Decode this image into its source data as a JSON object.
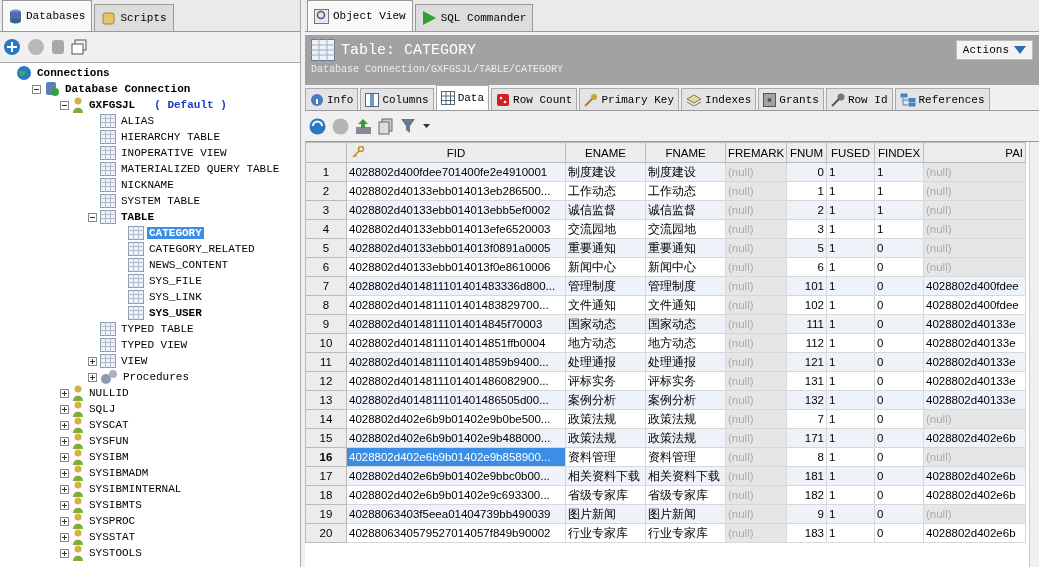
{
  "left_tabs": [
    {
      "label": "Databases",
      "selected": true
    },
    {
      "label": "Scripts",
      "selected": false
    }
  ],
  "tree": [
    {
      "label": "Connections",
      "kind": "globe",
      "bold": true,
      "selected": false,
      "children": [
        {
          "label": "Database Connection",
          "kind": "db",
          "bold": true,
          "selected": false,
          "expanded": true,
          "children": [
            {
              "label": "GXFGSJL",
              "note": "( Default )",
              "kind": "schema",
              "bold": true,
              "selected": false,
              "expanded": true,
              "children": [
                {
                  "label": "ALIAS",
                  "kind": "table",
                  "bold": false,
                  "selected": false
                },
                {
                  "label": "HIERARCHY TABLE",
                  "kind": "table",
                  "bold": false,
                  "selected": false
                },
                {
                  "label": "INOPERATIVE VIEW",
                  "kind": "table",
                  "bold": false,
                  "selected": false
                },
                {
                  "label": "MATERIALIZED QUERY TABLE",
                  "kind": "table",
                  "bold": false,
                  "selected": false
                },
                {
                  "label": "NICKNAME",
                  "kind": "table",
                  "bold": false,
                  "selected": false
                },
                {
                  "label": "SYSTEM TABLE",
                  "kind": "table",
                  "bold": false,
                  "selected": false
                },
                {
                  "label": "TABLE",
                  "kind": "table",
                  "bold": true,
                  "selected": false,
                  "expanded": true,
                  "children": [
                    {
                      "label": "CATEGORY",
                      "kind": "table",
                      "bold": true,
                      "selected": true
                    },
                    {
                      "label": "CATEGORY_RELATED",
                      "kind": "table",
                      "bold": false,
                      "selected": false
                    },
                    {
                      "label": "NEWS_CONTENT",
                      "kind": "table",
                      "bold": false,
                      "selected": false
                    },
                    {
                      "label": "SYS_FILE",
                      "kind": "table",
                      "bold": false,
                      "selected": false
                    },
                    {
                      "label": "SYS_LINK",
                      "kind": "table",
                      "bold": false,
                      "selected": false
                    },
                    {
                      "label": "SYS_USER",
                      "kind": "table",
                      "bold": true,
                      "selected": false
                    }
                  ]
                },
                {
                  "label": "TYPED TABLE",
                  "kind": "table",
                  "bold": false,
                  "selected": false
                },
                {
                  "label": "TYPED VIEW",
                  "kind": "table",
                  "bold": false,
                  "selected": false
                },
                {
                  "label": "VIEW",
                  "kind": "table",
                  "bold": false,
                  "selected": false,
                  "expanded": false
                },
                {
                  "label": "Procedures",
                  "kind": "gears",
                  "bold": false,
                  "selected": false,
                  "expanded": false
                }
              ]
            },
            {
              "label": "NULLID",
              "kind": "schema",
              "bold": false,
              "selected": false,
              "expanded": false
            },
            {
              "label": "SQLJ",
              "kind": "schema",
              "bold": false,
              "selected": false,
              "expanded": false
            },
            {
              "label": "SYSCAT",
              "kind": "schema",
              "bold": false,
              "selected": false,
              "expanded": false
            },
            {
              "label": "SYSFUN",
              "kind": "schema",
              "bold": false,
              "selected": false,
              "expanded": false
            },
            {
              "label": "SYSIBM",
              "kind": "schema",
              "bold": false,
              "selected": false,
              "expanded": false
            },
            {
              "label": "SYSIBMADM",
              "kind": "schema",
              "bold": false,
              "selected": false,
              "expanded": false
            },
            {
              "label": "SYSIBMINTERNAL",
              "kind": "schema",
              "bold": false,
              "selected": false,
              "expanded": false
            },
            {
              "label": "SYSIBMTS",
              "kind": "schema",
              "bold": false,
              "selected": false,
              "expanded": false
            },
            {
              "label": "SYSPROC",
              "kind": "schema",
              "bold": false,
              "selected": false,
              "expanded": false
            },
            {
              "label": "SYSSTAT",
              "kind": "schema",
              "bold": false,
              "selected": false,
              "expanded": false
            },
            {
              "label": "SYSTOOLS",
              "kind": "schema",
              "bold": false,
              "selected": false,
              "expanded": false
            }
          ]
        }
      ]
    }
  ],
  "main_tabs": [
    {
      "label": "Object View",
      "selected": true
    },
    {
      "label": "SQL Commander",
      "selected": false
    }
  ],
  "object": {
    "title": "Table: CATEGORY",
    "path": "Database Connection/GXFGSJL/TABLE/CATEGORY",
    "actions": "Actions"
  },
  "sub_tabs": [
    {
      "label": "Info",
      "selected": false
    },
    {
      "label": "Columns",
      "selected": false
    },
    {
      "label": "Data",
      "selected": true
    },
    {
      "label": "Row Count",
      "selected": false
    },
    {
      "label": "Primary Key",
      "selected": false
    },
    {
      "label": "Indexes",
      "selected": false
    },
    {
      "label": "Grants",
      "selected": false
    },
    {
      "label": "Row Id",
      "selected": false
    },
    {
      "label": "References",
      "selected": false
    }
  ],
  "table": {
    "columns": [
      {
        "label": "FID",
        "key": true
      },
      {
        "label": "ENAME",
        "key": false
      },
      {
        "label": "FNAME",
        "key": false
      },
      {
        "label": "FREMARK",
        "key": false
      },
      {
        "label": "FNUM",
        "key": false
      },
      {
        "label": "FUSED",
        "key": false
      },
      {
        "label": "FINDEX",
        "key": false
      },
      {
        "label": "PAI",
        "key": false
      }
    ],
    "rows": [
      {
        "num": "1",
        "selected": false,
        "fremark_null": true,
        "pai_null": true,
        "cells": [
          "4028802d400fdee701400fe2e4910001",
          "制度建设",
          "制度建设",
          "(null)",
          "0",
          "1",
          "1",
          "(null)"
        ]
      },
      {
        "num": "2",
        "selected": false,
        "fremark_null": true,
        "pai_null": true,
        "cells": [
          "4028802d40133ebb014013eb286500...",
          "工作动态",
          "工作动态",
          "(null)",
          "1",
          "1",
          "1",
          "(null)"
        ]
      },
      {
        "num": "3",
        "selected": false,
        "fremark_null": true,
        "pai_null": true,
        "cells": [
          "4028802d40133ebb014013ebb5ef0002",
          "诚信监督",
          "诚信监督",
          "(null)",
          "2",
          "1",
          "1",
          "(null)"
        ]
      },
      {
        "num": "4",
        "selected": false,
        "fremark_null": true,
        "pai_null": true,
        "cells": [
          "4028802d40133ebb014013efe6520003",
          "交流园地",
          "交流园地",
          "(null)",
          "3",
          "1",
          "1",
          "(null)"
        ]
      },
      {
        "num": "5",
        "selected": false,
        "fremark_null": true,
        "pai_null": true,
        "cells": [
          "4028802d40133ebb014013f0891a0005",
          "重要通知",
          "重要通知",
          "(null)",
          "5",
          "1",
          "0",
          "(null)"
        ]
      },
      {
        "num": "6",
        "selected": false,
        "fremark_null": true,
        "pai_null": true,
        "cells": [
          "4028802d40133ebb014013f0e8610006",
          "新闻中心",
          "新闻中心",
          "(null)",
          "6",
          "1",
          "0",
          "(null)"
        ]
      },
      {
        "num": "7",
        "selected": false,
        "fremark_null": true,
        "pai_null": false,
        "cells": [
          "4028802d4014811101401483336d800...",
          "管理制度",
          "管理制度",
          "(null)",
          "101",
          "1",
          "0",
          "4028802d400fdee"
        ]
      },
      {
        "num": "8",
        "selected": false,
        "fremark_null": true,
        "pai_null": false,
        "cells": [
          "4028802d4014811101401483829700...",
          "文件通知",
          "文件通知",
          "(null)",
          "102",
          "1",
          "0",
          "4028802d400fdee"
        ]
      },
      {
        "num": "9",
        "selected": false,
        "fremark_null": true,
        "pai_null": false,
        "cells": [
          "4028802d40148111014014845f70003",
          "国家动态",
          "国家动态",
          "(null)",
          "111",
          "1",
          "0",
          "4028802d40133e"
        ]
      },
      {
        "num": "10",
        "selected": false,
        "fremark_null": true,
        "pai_null": false,
        "cells": [
          "4028802d40148111014014851ffb0004",
          "地方动态",
          "地方动态",
          "(null)",
          "112",
          "1",
          "0",
          "4028802d40133e"
        ]
      },
      {
        "num": "11",
        "selected": false,
        "fremark_null": true,
        "pai_null": false,
        "cells": [
          "4028802d40148111014014859b9400...",
          "处理通报",
          "处理通报",
          "(null)",
          "121",
          "1",
          "0",
          "4028802d40133e"
        ]
      },
      {
        "num": "12",
        "selected": false,
        "fremark_null": true,
        "pai_null": false,
        "cells": [
          "4028802d4014811101401486082900...",
          "评标实务",
          "评标实务",
          "(null)",
          "131",
          "1",
          "0",
          "4028802d40133e"
        ]
      },
      {
        "num": "13",
        "selected": false,
        "fremark_null": true,
        "pai_null": false,
        "cells": [
          "4028802d4014811101401486505d00...",
          "案例分析",
          "案例分析",
          "(null)",
          "132",
          "1",
          "0",
          "4028802d40133e"
        ]
      },
      {
        "num": "14",
        "selected": false,
        "fremark_null": true,
        "pai_null": true,
        "cells": [
          "4028802d402e6b9b01402e9b0be500...",
          "政策法规",
          "政策法规",
          "(null)",
          "7",
          "1",
          "0",
          "(null)"
        ]
      },
      {
        "num": "15",
        "selected": false,
        "fremark_null": true,
        "pai_null": false,
        "cells": [
          "4028802d402e6b9b01402e9b488000...",
          "政策法规",
          "政策法规",
          "(null)",
          "171",
          "1",
          "0",
          "4028802d402e6b"
        ]
      },
      {
        "num": "16",
        "selected": true,
        "fremark_null": true,
        "pai_null": true,
        "cells": [
          "4028802d402e6b9b01402e9b858900...",
          "资料管理",
          "资料管理",
          "(null)",
          "8",
          "1",
          "0",
          "(null)"
        ]
      },
      {
        "num": "17",
        "selected": false,
        "fremark_null": true,
        "pai_null": false,
        "cells": [
          "4028802d402e6b9b01402e9bbc0b00...",
          "相关资料下载",
          "相关资料下载",
          "(null)",
          "181",
          "1",
          "0",
          "4028802d402e6b"
        ]
      },
      {
        "num": "18",
        "selected": false,
        "fremark_null": true,
        "pai_null": false,
        "cells": [
          "4028802d402e6b9b01402e9c693300...",
          "省级专家库",
          "省级专家库",
          "(null)",
          "182",
          "1",
          "0",
          "4028802d402e6b"
        ]
      },
      {
        "num": "19",
        "selected": false,
        "fremark_null": true,
        "pai_null": true,
        "cells": [
          "40288063403f5eea01404739bb490039",
          "图片新闻",
          "图片新闻",
          "(null)",
          "9",
          "1",
          "0",
          "(null)"
        ]
      },
      {
        "num": "20",
        "selected": false,
        "fremark_null": true,
        "pai_null": false,
        "cells": [
          "4028806340579527014057f849b90002",
          "行业专家库",
          "行业专家库",
          "(null)",
          "183",
          "1",
          "0",
          "4028802d402e6b"
        ]
      }
    ]
  }
}
